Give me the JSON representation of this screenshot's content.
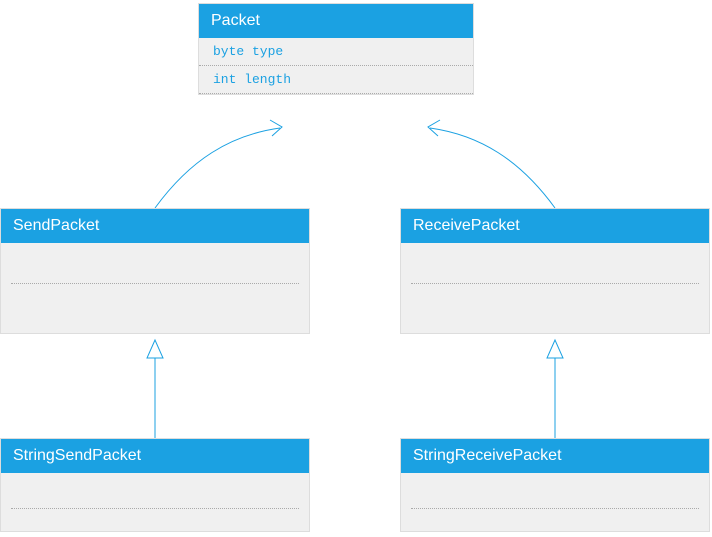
{
  "diagram": {
    "type": "uml-class-diagram",
    "classes": {
      "packet": {
        "name": "Packet",
        "fields": [
          "byte type",
          "int length"
        ]
      },
      "sendPacket": {
        "name": "SendPacket",
        "fields": []
      },
      "receivePacket": {
        "name": "ReceivePacket",
        "fields": []
      },
      "stringSendPacket": {
        "name": "StringSendPacket",
        "fields": []
      },
      "stringReceivePacket": {
        "name": "StringReceivePacket",
        "fields": []
      }
    },
    "relations": [
      {
        "from": "sendPacket",
        "to": "packet",
        "type": "realization"
      },
      {
        "from": "receivePacket",
        "to": "packet",
        "type": "realization"
      },
      {
        "from": "stringSendPacket",
        "to": "sendPacket",
        "type": "generalization"
      },
      {
        "from": "stringReceivePacket",
        "to": "receivePacket",
        "type": "generalization"
      }
    ],
    "colors": {
      "accent": "#1ba1e2",
      "body": "#f0f0f0"
    }
  }
}
